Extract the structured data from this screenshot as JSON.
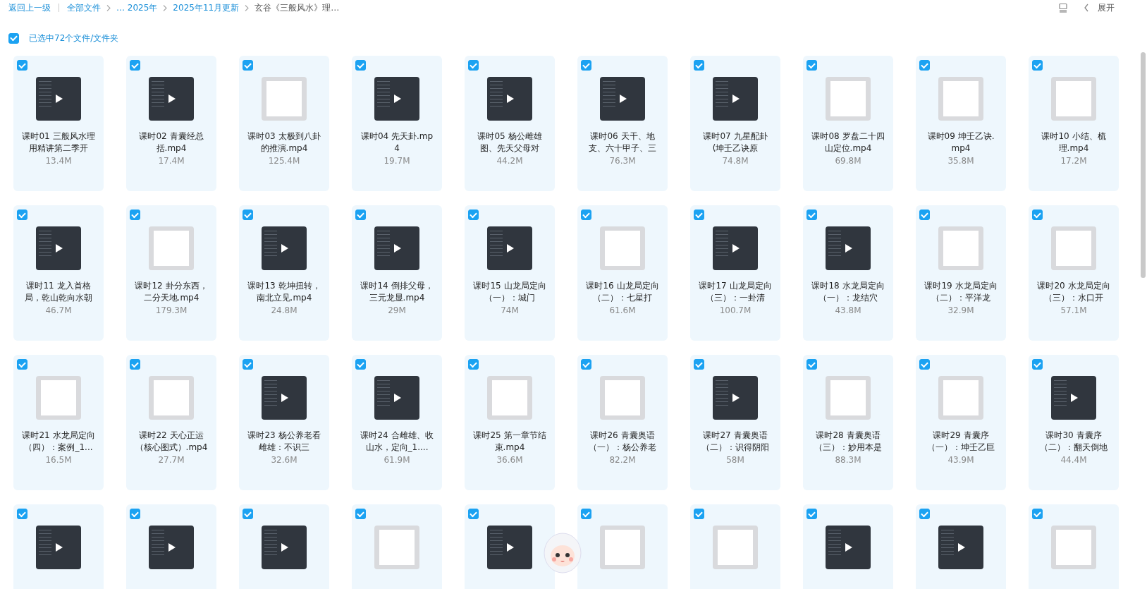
{
  "toolbar": {
    "back_link": "返回上一级",
    "breadcrumbs": [
      {
        "label": "全部文件"
      },
      {
        "label": "… 2025年"
      },
      {
        "label": "2025年11月更新"
      },
      {
        "label": "玄谷《三般风水》理…"
      }
    ],
    "expand_label": "展开"
  },
  "selection": {
    "checked": true,
    "label": "已选中72个文件/文件夹"
  },
  "files": [
    {
      "kind": "video",
      "name_lines": [
        "课时01 三般风水理",
        "用精讲第二季开"
      ],
      "size": "13.4M",
      "selected": true
    },
    {
      "kind": "video",
      "name_lines": [
        "课时02 青囊经总",
        "括.mp4"
      ],
      "size": "17.4M",
      "selected": true
    },
    {
      "kind": "doc",
      "name_lines": [
        "课时03 太极到八卦",
        "的推演.mp4"
      ],
      "size": "125.4M",
      "selected": true
    },
    {
      "kind": "video",
      "name_lines": [
        "课时04 先天卦.mp",
        "4"
      ],
      "size": "19.7M",
      "selected": true
    },
    {
      "kind": "video",
      "name_lines": [
        "课时05 杨公雌雄",
        "图、先天父母对"
      ],
      "size": "44.2M",
      "selected": true
    },
    {
      "kind": "video",
      "name_lines": [
        "课时06 天干、地",
        "支、六十甲子、三"
      ],
      "size": "76.3M",
      "selected": true
    },
    {
      "kind": "video",
      "name_lines": [
        "课时07 九星配卦",
        "(坤壬乙诀原"
      ],
      "size": "74.8M",
      "selected": true
    },
    {
      "kind": "doc",
      "name_lines": [
        "课时08 罗盘二十四",
        "山定位.mp4"
      ],
      "size": "69.8M",
      "selected": true
    },
    {
      "kind": "doc",
      "name_lines": [
        "课时09 坤壬乙诀.",
        "mp4"
      ],
      "size": "35.8M",
      "selected": true
    },
    {
      "kind": "doc",
      "name_lines": [
        "课时10 小结、梳",
        "理.mp4"
      ],
      "size": "17.2M",
      "selected": true
    },
    {
      "kind": "video",
      "name_lines": [
        "课时11 龙入首格",
        "局，乾山乾向水朝"
      ],
      "size": "46.7M",
      "selected": true
    },
    {
      "kind": "doc",
      "name_lines": [
        "课时12 卦分东西，",
        "二分天地.mp4"
      ],
      "size": "179.3M",
      "selected": true
    },
    {
      "kind": "video",
      "name_lines": [
        "课时13 乾坤扭转，",
        "南北立见.mp4"
      ],
      "size": "24.8M",
      "selected": true
    },
    {
      "kind": "video",
      "name_lines": [
        "课时14 倒排父母，",
        "三元龙显.mp4"
      ],
      "size": "29M",
      "selected": true
    },
    {
      "kind": "video",
      "name_lines": [
        "课时15 山龙局定向",
        "（一）：城门"
      ],
      "size": "74M",
      "selected": true
    },
    {
      "kind": "doc",
      "name_lines": [
        "课时16 山龙局定向",
        "（二）：七星打"
      ],
      "size": "61.6M",
      "selected": true
    },
    {
      "kind": "video",
      "name_lines": [
        "课时17 山龙局定向",
        "（三）：一卦清"
      ],
      "size": "100.7M",
      "selected": true
    },
    {
      "kind": "video",
      "name_lines": [
        "课时18 水龙局定向",
        "（一）：龙结穴"
      ],
      "size": "43.8M",
      "selected": true
    },
    {
      "kind": "doc",
      "name_lines": [
        "课时19 水龙局定向",
        "（二）：平洋龙"
      ],
      "size": "32.9M",
      "selected": true
    },
    {
      "kind": "doc",
      "name_lines": [
        "课时20 水龙局定向",
        "（三）：水口开"
      ],
      "size": "57.1M",
      "selected": true
    },
    {
      "kind": "doc",
      "name_lines": [
        "课时21 水龙局定向",
        "（四）：案例_1..."
      ],
      "size": "16.5M",
      "selected": true
    },
    {
      "kind": "doc",
      "name_lines": [
        "课时22 天心正运",
        "（核心图式）.mp4"
      ],
      "size": "27.7M",
      "selected": true
    },
    {
      "kind": "video",
      "name_lines": [
        "课时23 杨公养老看",
        "雌雄：不识三"
      ],
      "size": "32.6M",
      "selected": true
    },
    {
      "kind": "video",
      "name_lines": [
        "课时24 合雌雄、收",
        "山水，定向_1...."
      ],
      "size": "61.9M",
      "selected": true
    },
    {
      "kind": "doc",
      "name_lines": [
        "课时25 第一章节结",
        "束.mp4"
      ],
      "size": "36.6M",
      "selected": true
    },
    {
      "kind": "doc",
      "name_lines": [
        "课时26 青囊奥语",
        "（一）：杨公养老"
      ],
      "size": "82.2M",
      "selected": true
    },
    {
      "kind": "video",
      "name_lines": [
        "课时27 青囊奥语",
        "（二）：识得阴阳"
      ],
      "size": "58M",
      "selected": true
    },
    {
      "kind": "doc",
      "name_lines": [
        "课时28 青囊奥语",
        "（三）：妙用本是"
      ],
      "size": "88.3M",
      "selected": true
    },
    {
      "kind": "doc",
      "name_lines": [
        "课时29 青囊序",
        "（一）：坤壬乙巨"
      ],
      "size": "43.9M",
      "selected": true
    },
    {
      "kind": "video",
      "name_lines": [
        "课时30 青囊序",
        "（二）：翻天倒地"
      ],
      "size": "44.4M",
      "selected": true
    },
    {
      "kind": "video",
      "selected": true
    },
    {
      "kind": "video",
      "selected": true
    },
    {
      "kind": "video",
      "selected": true
    },
    {
      "kind": "doc",
      "selected": true
    },
    {
      "kind": "video",
      "selected": true
    },
    {
      "kind": "doc",
      "selected": true
    },
    {
      "kind": "doc",
      "selected": true
    },
    {
      "kind": "video",
      "selected": true
    },
    {
      "kind": "video",
      "selected": true
    },
    {
      "kind": "doc",
      "selected": true
    }
  ]
}
